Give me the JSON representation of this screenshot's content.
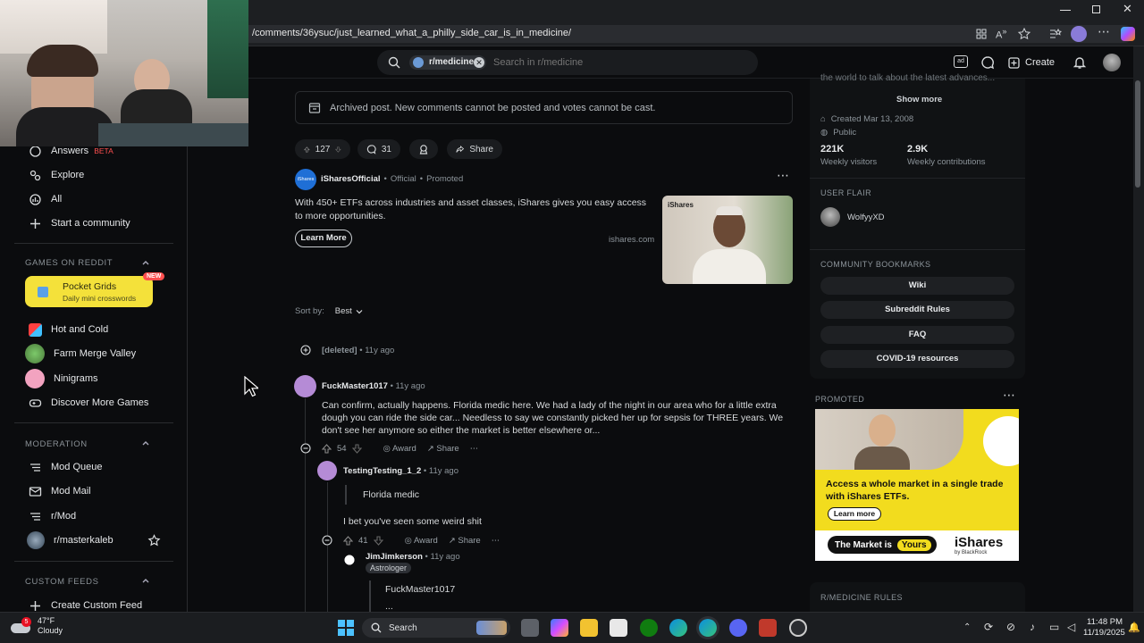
{
  "browser": {
    "url": "/comments/36ysuc/just_learned_what_a_philly_side_car_is_in_medicine/"
  },
  "header": {
    "search_chip": "r/medicine",
    "search_placeholder": "Search in r/medicine",
    "create_label": "Create"
  },
  "sidebar": {
    "items": [
      {
        "label": "Answers",
        "badge": "BETA",
        "icon": "answers-icon"
      },
      {
        "label": "Explore",
        "icon": "explore-icon"
      },
      {
        "label": "All",
        "icon": "all-icon"
      },
      {
        "label": "Start a community",
        "icon": "plus-icon"
      }
    ],
    "games_header": "GAMES ON REDDIT",
    "pocket_grids": {
      "title": "Pocket Grids",
      "subtitle": "Daily mini crosswords",
      "badge": "NEW"
    },
    "games": [
      {
        "label": "Hot and Cold"
      },
      {
        "label": "Farm Merge Valley"
      },
      {
        "label": "Ninigrams"
      },
      {
        "label": "Discover More Games"
      }
    ],
    "moderation_header": "MODERATION",
    "moderation": [
      {
        "label": "Mod Queue"
      },
      {
        "label": "Mod Mail"
      },
      {
        "label": "r/Mod"
      },
      {
        "label": "r/masterkaleb"
      }
    ],
    "custom_feeds_header": "CUSTOM FEEDS",
    "create_custom_feed": "Create Custom Feed"
  },
  "post": {
    "archived_notice": "Archived post. New comments cannot be posted and votes cannot be cast.",
    "votes": "127",
    "comments": "31",
    "share": "Share"
  },
  "promo": {
    "author": "iSharesOfficial",
    "official": "Official",
    "promoted": "Promoted",
    "text": "With 450+ ETFs across industries and asset classes, iShares gives you easy access to more opportunities.",
    "button": "Learn More",
    "domain": "ishares.com",
    "image_brand": "iShares"
  },
  "sort": {
    "label": "Sort by:",
    "value": "Best"
  },
  "comments": [
    {
      "author": "[deleted]",
      "time": "11y ago"
    },
    {
      "author": "FuckMaster1017",
      "time": "11y ago",
      "text": "Can confirm, actually happens. Florida medic here. We had a lady of the night in our area who for a little extra dough you can ride the side car... Needless to say we constantly picked her up for sepsis for THREE years. We don't see her anymore so either the market is better elsewhere or...",
      "votes": "54",
      "award": "Award",
      "share": "Share"
    },
    {
      "author": "TestingTesting_1_2",
      "time": "11y ago",
      "quote": "Florida medic",
      "text": "I bet you've seen some weird shit",
      "votes": "41",
      "award": "Award",
      "share": "Share"
    },
    {
      "author": "JimJimkerson",
      "time": "11y ago",
      "flair": "Astrologer",
      "quote": "FuckMaster1017",
      "text": "..."
    }
  ],
  "right": {
    "show_more": "Show more",
    "truncated": "the world to talk about the latest advances...",
    "created": "Created Mar 13, 2008",
    "public": "Public",
    "visitors": "221K",
    "visitors_label": "Weekly visitors",
    "contributions": "2.9K",
    "contributions_label": "Weekly contributions",
    "user_flair_header": "USER FLAIR",
    "user_flair_name": "WolfyyXD",
    "bookmarks_header": "COMMUNITY BOOKMARKS",
    "bookmarks": [
      "Wiki",
      "Subreddit Rules",
      "FAQ",
      "COVID-19 resources"
    ],
    "promoted_header": "PROMOTED",
    "rules_header": "R/MEDICINE RULES"
  },
  "ad": {
    "headline": "Access a whole market in a single trade with iShares ETFs.",
    "button": "Learn more",
    "tag_left": "The Market is",
    "tag_right": "Yours",
    "brand": "iShares",
    "brand_sub": "by BlackRock"
  },
  "taskbar": {
    "temp": "47°F",
    "weather": "Cloudy",
    "weather_badge": "5",
    "search": "Search",
    "time": "11:48 PM",
    "date": "11/19/2025"
  },
  "colors": {
    "accent": "#ff4500",
    "ad_yellow": "#f2dc1e",
    "link_blue": "#4a9eff"
  }
}
